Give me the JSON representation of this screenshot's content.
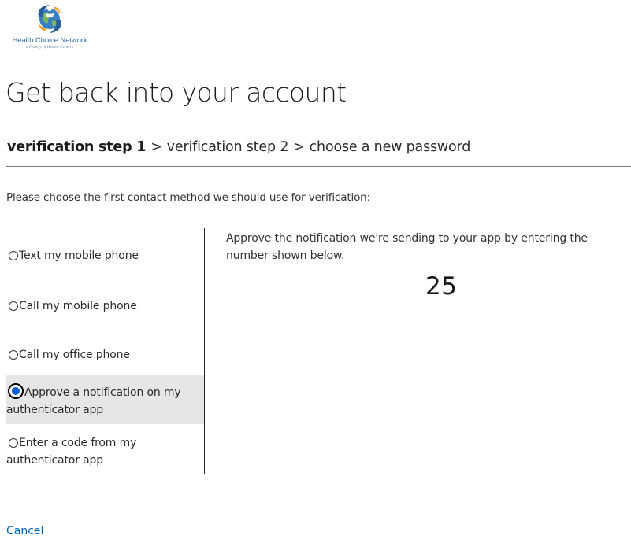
{
  "logo": {
    "name": "Health Choice Network",
    "tagline": "a Family of Health Centers"
  },
  "title": "Get back into your account",
  "breadcrumb": {
    "current": "verification step 1",
    "separator": ">",
    "steps": [
      "verification step 2",
      "choose a new password"
    ]
  },
  "instruction": "Please choose the first contact method we should use for verification:",
  "options": [
    {
      "label": "Text my mobile phone",
      "selected": false
    },
    {
      "label": "Call my mobile phone",
      "selected": false
    },
    {
      "label": "Call my office phone",
      "selected": false
    },
    {
      "label": "Approve a notification on my authenticator app",
      "selected": true
    },
    {
      "label": "Enter a code from my authenticator app",
      "selected": false
    }
  ],
  "panel": {
    "message": "Approve the notification we're sending to your app by entering the number shown below.",
    "number": "25"
  },
  "cancel_label": "Cancel",
  "colors": {
    "link": "#0067b8",
    "selected_background": "#e6e6e6",
    "radio_checked": "#0a5fd6"
  }
}
